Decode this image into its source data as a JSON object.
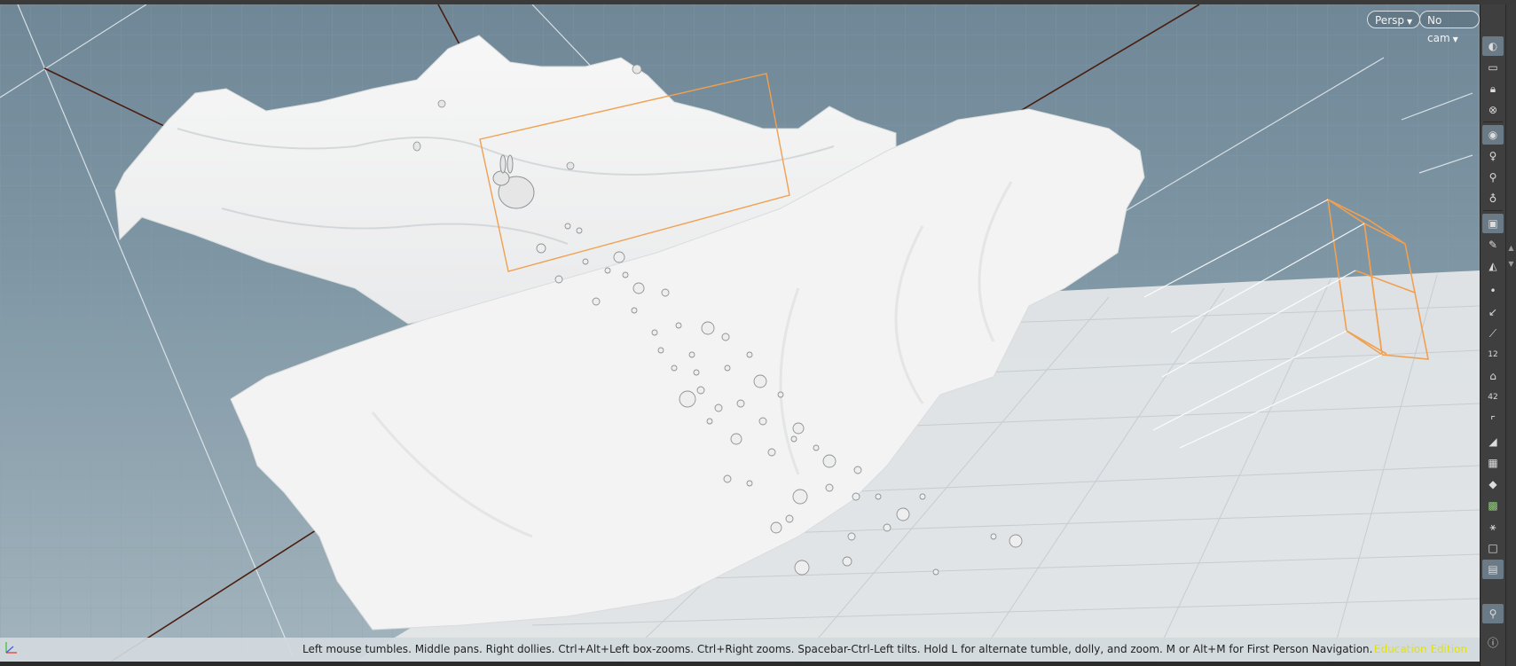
{
  "viewport": {
    "persp_label": "Persp",
    "cam_label": "No cam",
    "hint_text": "Left mouse tumbles. Middle pans. Right dollies. Ctrl+Alt+Left box-zooms. Ctrl+Right zooms. Spacebar-Ctrl-Left tilts. Hold L for alternate tumble, dolly, and zoom.     M or Alt+M for First Person Navigation.",
    "edition_label": "Education Edition"
  },
  "toolbar": {
    "icons": [
      "view-icon",
      "select-icon",
      "lock-icon",
      "close-icon",
      "camera-icon",
      "light-icon",
      "light-add-icon",
      "light-settings-icon",
      "display-icon",
      "brush-icon",
      "shade-icon",
      "point-icon",
      "edge-icon",
      "wand-icon",
      "number-12-icon",
      "paint-icon",
      "number-42-icon",
      "corner-icon",
      "wedge-icon",
      "checker-icon",
      "diamond-icon",
      "grid-icon",
      "node-icon",
      "square-icon",
      "screen-icon",
      "pin-icon",
      "info-icon"
    ],
    "numeric_labels": {
      "twelve": "12",
      "forty_two": "42"
    }
  },
  "colors": {
    "viewport_sky": "#7f97a5",
    "selection_box": "#f0a050",
    "edition_text": "#e3e300"
  }
}
